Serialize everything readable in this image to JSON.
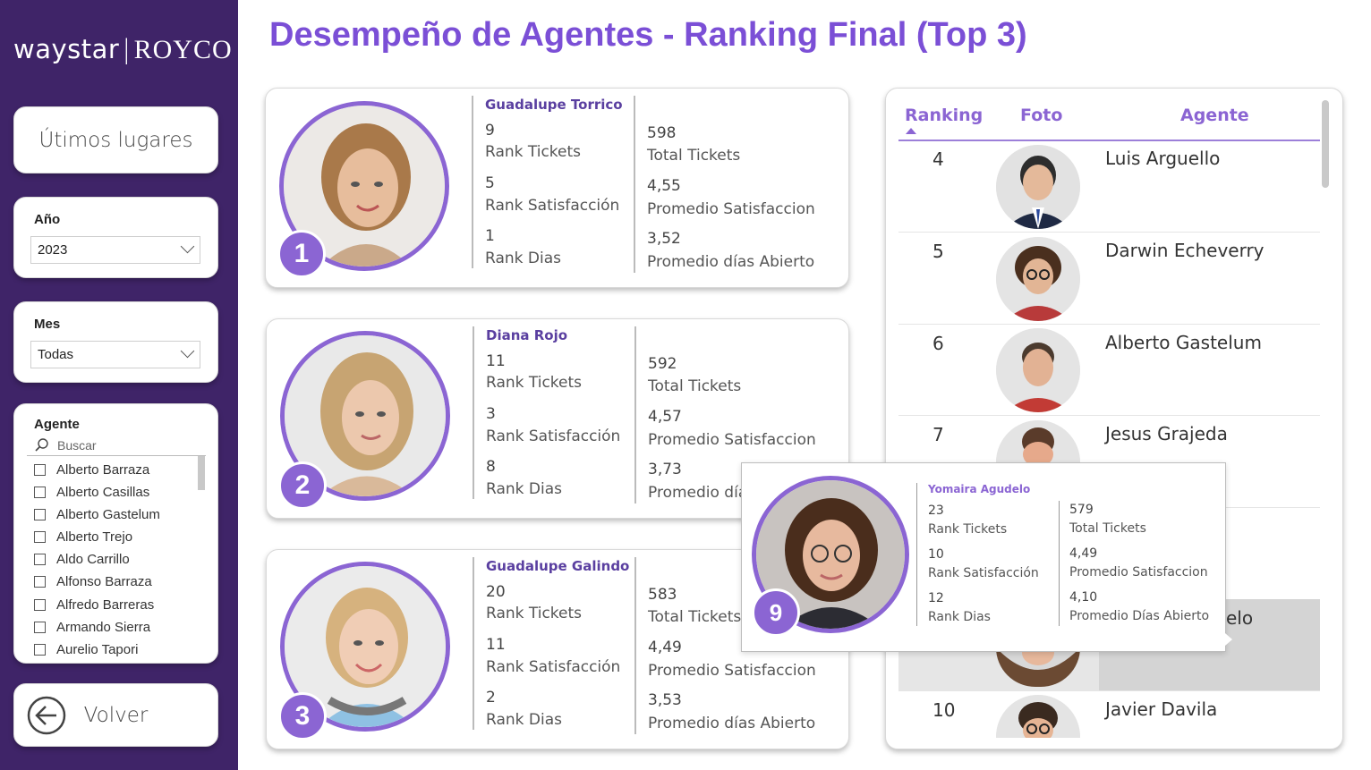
{
  "brand": {
    "logo_left": "waystar",
    "logo_sep": "|",
    "logo_right": "ROYCO"
  },
  "page": {
    "title": "Desempeño de Agentes - Ranking Final (Top 3)"
  },
  "sidebar": {
    "last_places_button": "Útimos lugares",
    "year": {
      "label": "Año",
      "value": "2023"
    },
    "month": {
      "label": "Mes",
      "value": "Todas"
    },
    "agent": {
      "label": "Agente",
      "search_placeholder": "Buscar",
      "items": [
        "Alberto Barraza",
        "Alberto Casillas",
        "Alberto Gastelum",
        "Alberto Trejo",
        "Aldo Carrillo",
        "Alfonso Barraza",
        "Alfredo Barreras",
        "Armando Sierra",
        "Aurelio Tapori"
      ]
    },
    "back_button": "Volver"
  },
  "top3": [
    {
      "badge": "1",
      "name": "Guadalupe Torrico",
      "rank_tickets": "9",
      "rank_tickets_label": "Rank Tickets",
      "rank_satisfaccion": "5",
      "rank_satisfaccion_label": "Rank Satisfacción",
      "rank_dias": "1",
      "rank_dias_label": "Rank Dias",
      "total_tickets": "598",
      "total_tickets_label": "Total Tickets",
      "promedio_satisfaccion": "4,55",
      "promedio_satisfaccion_label": "Promedio Satisfaccion",
      "promedio_dias": "3,52",
      "promedio_dias_label": "Promedio días Abierto"
    },
    {
      "badge": "2",
      "name": "Diana Rojo",
      "rank_tickets": "11",
      "rank_tickets_label": "Rank Tickets",
      "rank_satisfaccion": "3",
      "rank_satisfaccion_label": "Rank Satisfacción",
      "rank_dias": "8",
      "rank_dias_label": "Rank Dias",
      "total_tickets": "592",
      "total_tickets_label": "Total Tickets",
      "promedio_satisfaccion": "4,57",
      "promedio_satisfaccion_label": "Promedio Satisfaccion",
      "promedio_dias": "3,73",
      "promedio_dias_label": "Promedio días Abierto"
    },
    {
      "badge": "3",
      "name": "Guadalupe Galindo",
      "rank_tickets": "20",
      "rank_tickets_label": "Rank Tickets",
      "rank_satisfaccion": "11",
      "rank_satisfaccion_label": "Rank Satisfacción",
      "rank_dias": "2",
      "rank_dias_label": "Rank Dias",
      "total_tickets": "583",
      "total_tickets_label": "Total Tickets",
      "promedio_satisfaccion": "4,49",
      "promedio_satisfaccion_label": "Promedio Satisfaccion",
      "promedio_dias": "3,53",
      "promedio_dias_label": "Promedio días Abierto"
    }
  ],
  "table": {
    "headers": {
      "ranking": "Ranking",
      "foto": "Foto",
      "agente": "Agente"
    },
    "rows": [
      {
        "rank": "4",
        "name": "Luis Arguello"
      },
      {
        "rank": "5",
        "name": "Darwin Echeverry"
      },
      {
        "rank": "6",
        "name": "Alberto Gastelum"
      },
      {
        "rank": "7",
        "name": "Jesus Grajeda"
      },
      {
        "rank": "10",
        "name": "Javier Davila"
      }
    ],
    "hidden_row_fragment": "elo"
  },
  "tooltip": {
    "badge": "9",
    "name": "Yomaira Agudelo",
    "rank_tickets": "23",
    "rank_tickets_label": "Rank Tickets",
    "rank_satisfaccion": "10",
    "rank_satisfaccion_label": "Rank Satisfacción",
    "rank_dias": "12",
    "rank_dias_label": "Rank Dias",
    "total_tickets": "579",
    "total_tickets_label": "Total Tickets",
    "promedio_satisfaccion": "4,49",
    "promedio_satisfaccion_label": "Promedio Satisfaccion",
    "promedio_dias": "4,10",
    "promedio_dias_label": "Promedio Días Abierto"
  },
  "colors": {
    "sidebar": "#3f2468",
    "accent": "#8b65d3",
    "title": "#7b4fd6"
  }
}
